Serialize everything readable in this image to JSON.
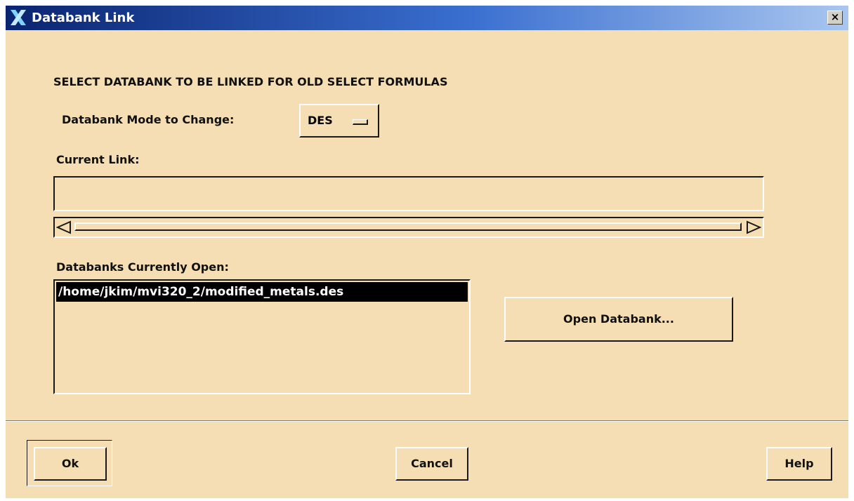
{
  "window": {
    "title": "Databank Link",
    "close_label": "×"
  },
  "heading": "SELECT DATABANK TO BE LINKED FOR OLD SELECT FORMULAS",
  "mode": {
    "label": "Databank Mode to Change:",
    "value": "DES"
  },
  "current_link": {
    "label": "Current Link:",
    "value": ""
  },
  "databanks": {
    "label": "Databanks Currently Open:",
    "items": [
      "/home/jkim/mvi320_2/modified_metals.des"
    ]
  },
  "buttons": {
    "open_databank": "Open Databank...",
    "ok": "Ok",
    "cancel": "Cancel",
    "help": "Help"
  },
  "colors": {
    "background": "#f5deb3",
    "titlebar_start": "#0a2470",
    "titlebar_end": "#a9c6ef",
    "selection": "#000000"
  },
  "icons": {
    "app": "x-logo-icon",
    "close": "close-icon",
    "option_menu": "option-menu-indicator-icon",
    "scroll_left": "scroll-left-arrow-icon",
    "scroll_right": "scroll-right-arrow-icon"
  }
}
